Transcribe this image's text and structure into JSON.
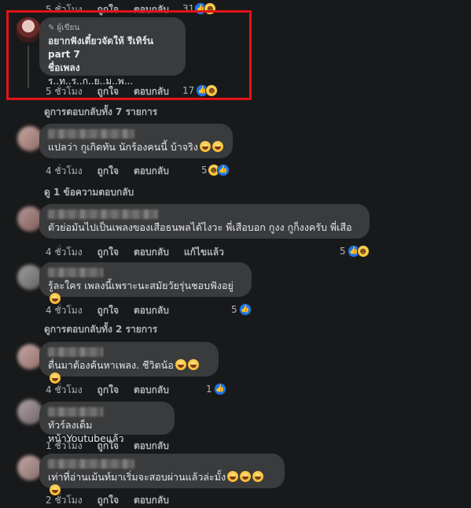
{
  "top_row": {
    "time": "5 ชั่วโมง",
    "like": "ถูกใจ",
    "reply": "ตอบกลับ",
    "count": "31"
  },
  "highlighted": {
    "author_badge": "ผู้เขียน",
    "line1": "อยากฟังเดี๋ยวจัดให้ รีเทิร์น part 7",
    "line2": "ชื่อเพลง",
    "line3": "ร..ท..ร..ก..ย..ม..พ...",
    "time": "5 ชั่วโมง",
    "like": "ถูกใจ",
    "reply": "ตอบกลับ",
    "count": "17"
  },
  "view_replies_1": "ดูการตอบกลับทั้ง 7 รายการ",
  "c1": {
    "text": "แปลว่า กูเกิดทัน นักร้องคนนี้ บ้าจริง",
    "time": "4 ชั่วโมง",
    "reply": "ตอบกลับ",
    "count": "5"
  },
  "view_reply_1": "ดู 1 ข้อความตอบกลับ",
  "c2": {
    "text": "ตัวย่อมันไปเป็นเพลงของเสือธนพลได้ไงวะ พี่เสือบอก กูงง กูก็งงครับ พี่เสือ",
    "time": "4 ชั่วโมง",
    "like": "ถูกใจ",
    "reply": "ตอบกลับ",
    "edited": "แก้ไขแล้ว",
    "count": "5"
  },
  "c3": {
    "text": "รู้ละใคร เพลงนี้เพราะนะสมัยวัยรุ่นชอบฟังอยู่",
    "time": "4 ชั่วโมง",
    "like": "ถูกใจ",
    "reply": "ตอบกลับ",
    "count": "5"
  },
  "view_replies_2": "ดูการตอบกลับทั้ง 2 รายการ",
  "c4": {
    "text": "ตื่นมาต้องค้นหาเพลง. ชีวิตน้อ",
    "time": "4 ชั่วโมง",
    "like": "ถูกใจ",
    "reply": "ตอบกลับ",
    "count": "1"
  },
  "c5": {
    "text": "ทัวร์ลงเต็มหน้าYoutubeแล้ว",
    "time": "1 ชั่วโมง",
    "like": "ถูกใจ",
    "reply": "ตอบกลับ"
  },
  "c6": {
    "text": "เท่าที่อ่านเม้นท์มาเริ่มจะสอบผ่านแล้วล่ะมั้ง",
    "time": "2 ชั่วโมง",
    "like": "ถูกใจ",
    "reply": "ตอบกลับ"
  },
  "icons": {
    "like": "thumbs-up-icon",
    "haha": "haha-emoji-icon",
    "pencil": "pencil-icon"
  }
}
